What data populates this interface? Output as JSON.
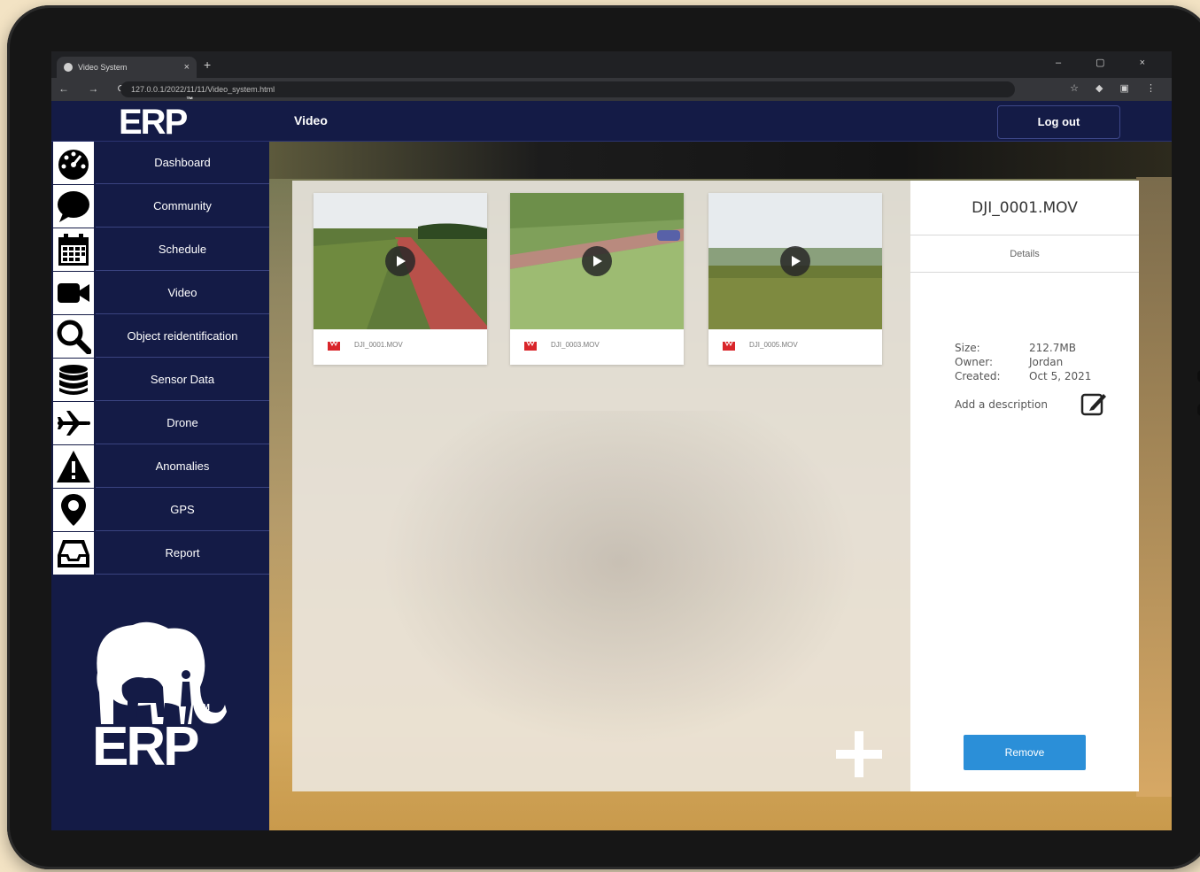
{
  "browser": {
    "tab_title": "Video System",
    "url": "127.0.0.1/2022/11/11/Video_system.html"
  },
  "header": {
    "brand": "ERP",
    "brand_tm": "™",
    "title": "Video",
    "logout_label": "Log out"
  },
  "sidebar": {
    "items": [
      {
        "label": "Dashboard",
        "icon": "dashboard-icon"
      },
      {
        "label": "Community",
        "icon": "speech-bubble-icon"
      },
      {
        "label": "Schedule",
        "icon": "calendar-icon"
      },
      {
        "label": "Video",
        "icon": "video-camera-icon"
      },
      {
        "label": "Object reidentification",
        "icon": "search-icon"
      },
      {
        "label": "Sensor Data",
        "icon": "database-icon"
      },
      {
        "label": "Drone",
        "icon": "airplane-icon"
      },
      {
        "label": "Anomalies",
        "icon": "warning-icon"
      },
      {
        "label": "GPS",
        "icon": "map-pin-icon"
      },
      {
        "label": "Report",
        "icon": "inbox-icon"
      }
    ],
    "logo_text": "ERP",
    "logo_tm": "TM"
  },
  "videos": [
    {
      "name": "DJI_0001.MOV"
    },
    {
      "name": "DJI_0003.MOV"
    },
    {
      "name": "DJI_0005.MOV"
    }
  ],
  "details": {
    "title": "DJI_0001.MOV",
    "tab": "Details",
    "size_label": "Size:",
    "size": "212.7MB",
    "owner_label": "Owner:",
    "owner": "Jordan",
    "created_label": "Created:",
    "created": "Oct 5, 2021",
    "description_placeholder": "Add a description",
    "remove_label": "Remove"
  },
  "colors": {
    "navy": "#141b46",
    "accent_blue": "#2b8fd8",
    "file_icon_red": "#d9252a"
  }
}
